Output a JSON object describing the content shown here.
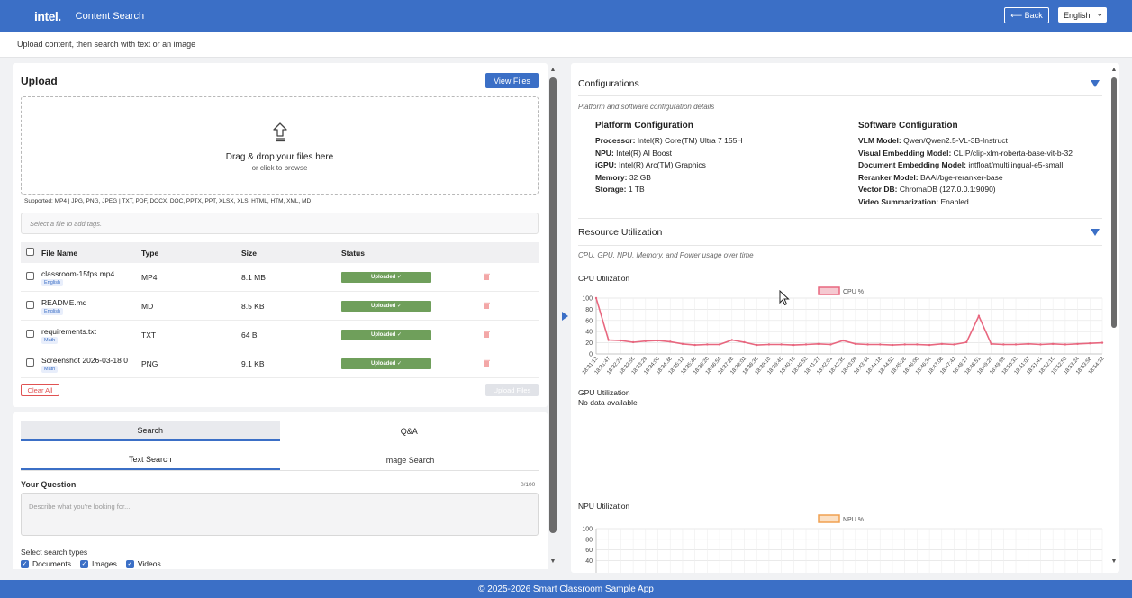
{
  "header": {
    "logo": "intel.",
    "title": "Content Search",
    "back_label": "⟵ Back",
    "language": "English"
  },
  "subheader": "Upload content, then search with text or an image",
  "upload": {
    "title": "Upload",
    "view_files": "View Files",
    "drop_title": "Drag & drop your files here",
    "drop_sub": "or click to browse",
    "supported": "Supported: MP4 | JPG, PNG, JPEG | TXT, PDF, DOCX, DOC, PPTX, PPT, XLSX, XLS, HTML, HTM, XML, MD",
    "tag_placeholder": "Select a file to add tags.",
    "columns": [
      "File Name",
      "Type",
      "Size",
      "Status"
    ],
    "files": [
      {
        "name": "classroom-15fps.mp4",
        "tag": "English",
        "type": "MP4",
        "size": "8.1 MB",
        "status": "Uploaded ✓"
      },
      {
        "name": "README.md",
        "tag": "English",
        "type": "MD",
        "size": "8.5 KB",
        "status": "Uploaded ✓"
      },
      {
        "name": "requirements.txt",
        "tag": "Math",
        "type": "TXT",
        "size": "64 B",
        "status": "Uploaded ✓"
      },
      {
        "name": "Screenshot 2026-03-18 0",
        "tag": "Math",
        "type": "PNG",
        "size": "9.1 KB",
        "status": "Uploaded ✓"
      }
    ],
    "clear_all": "Clear All",
    "upload_files": "Upload Files"
  },
  "search": {
    "tabs": [
      "Search",
      "Q&A"
    ],
    "subtabs": [
      "Text Search",
      "Image Search"
    ],
    "question_label": "Your Question",
    "question_count": "0/100",
    "question_placeholder": "Describe what you're looking for...",
    "types_label": "Select search types",
    "types": [
      "Documents",
      "Images",
      "Videos"
    ]
  },
  "config": {
    "title": "Configurations",
    "desc": "Platform and software configuration details",
    "platform_heading": "Platform Configuration",
    "platform": [
      {
        "k": "Processor:",
        "v": "Intel(R) Core(TM) Ultra 7 155H"
      },
      {
        "k": "NPU:",
        "v": "Intel(R) AI Boost"
      },
      {
        "k": "iGPU:",
        "v": "Intel(R) Arc(TM) Graphics"
      },
      {
        "k": "Memory:",
        "v": "32 GB"
      },
      {
        "k": "Storage:",
        "v": "1 TB"
      }
    ],
    "software_heading": "Software Configuration",
    "software": [
      {
        "k": "VLM Model:",
        "v": "Qwen/Qwen2.5-VL-3B-Instruct"
      },
      {
        "k": "Visual Embedding Model:",
        "v": "CLIP/clip-xlm-roberta-base-vit-b-32"
      },
      {
        "k": "Document Embedding Model:",
        "v": "intfloat/multilingual-e5-small"
      },
      {
        "k": "Reranker Model:",
        "v": "BAAI/bge-reranker-base"
      },
      {
        "k": "Vector DB:",
        "v": "ChromaDB (127.0.0.1:9090)"
      },
      {
        "k": "Video Summarization:",
        "v": "Enabled"
      }
    ]
  },
  "resources": {
    "title": "Resource Utilization",
    "desc": "CPU, GPU, NPU, Memory, and Power usage over time",
    "cpu_label": "CPU Utilization",
    "gpu_label": "GPU Utilization",
    "gpu_nodata": "No data available",
    "npu_label": "NPU Utilization"
  },
  "footer": "© 2025-2026 Smart Classroom Sample App",
  "colors": {
    "brand": "#3b6fc6",
    "cpu_line": "#e8677f",
    "npu_line": "#f0a050",
    "uploaded": "#6f9f5b",
    "danger": "#e05252"
  },
  "chart_data": [
    {
      "type": "line",
      "title": "",
      "ylabel": "",
      "xlabel": "",
      "ylim": [
        0,
        100
      ],
      "yticks": [
        0,
        20,
        40,
        60,
        80,
        100
      ],
      "x": [
        "18:31:13",
        "18:31:47",
        "18:32:21",
        "18:32:55",
        "18:33:29",
        "18:34:03",
        "18:34:38",
        "18:35:12",
        "18:35:46",
        "18:36:20",
        "18:36:54",
        "18:37:28",
        "18:38:02",
        "18:38:36",
        "18:39:10",
        "18:39:45",
        "18:40:19",
        "18:40:53",
        "18:41:27",
        "18:42:01",
        "18:42:35",
        "18:43:09",
        "18:43:44",
        "18:44:18",
        "18:44:52",
        "18:45:26",
        "18:46:00",
        "18:46:34",
        "18:47:08",
        "18:47:42",
        "18:48:17",
        "18:48:51",
        "18:49:25",
        "18:49:59",
        "18:50:33",
        "18:51:07",
        "18:51:41",
        "18:52:15",
        "18:52:50",
        "18:53:24",
        "18:53:58",
        "18:54:32"
      ],
      "series": [
        {
          "name": "CPU %",
          "values": [
            100,
            25,
            24,
            21,
            23,
            24,
            22,
            18,
            16,
            17,
            17,
            25,
            21,
            16,
            17,
            17,
            16,
            17,
            18,
            17,
            24,
            18,
            17,
            17,
            16,
            17,
            17,
            16,
            18,
            17,
            21,
            68,
            18,
            17,
            17,
            18,
            17,
            18,
            17,
            18,
            19,
            20
          ]
        }
      ]
    },
    {
      "type": "line",
      "title": "",
      "ylim": [
        0,
        100
      ],
      "yticks": [
        40,
        60,
        80,
        100
      ],
      "series": [
        {
          "name": "NPU %",
          "values": []
        }
      ]
    }
  ]
}
